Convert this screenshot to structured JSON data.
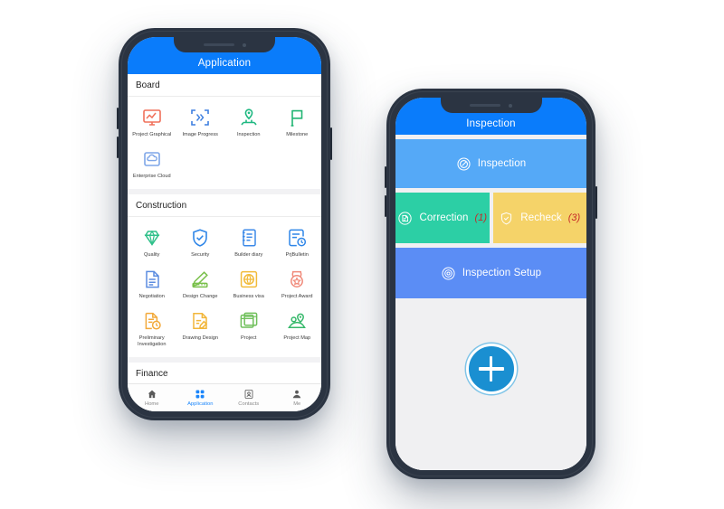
{
  "phone_one": {
    "appbar_title": "Application",
    "sections": [
      {
        "title": "Board",
        "items": [
          {
            "label": "Project Graphical",
            "icon": "monitor-chart-icon",
            "color": "#f0705a"
          },
          {
            "label": "Image Progress",
            "icon": "image-progress-icon",
            "color": "#3d7fe0"
          },
          {
            "label": "Inspection",
            "icon": "map-pin-inspection-icon",
            "color": "#1eb881"
          },
          {
            "label": "Milestone",
            "icon": "flag-icon",
            "color": "#21b573"
          },
          {
            "label": "Enterprise Cloud",
            "icon": "cloud-box-icon",
            "color": "#7ea6e8"
          }
        ]
      },
      {
        "title": "Construction",
        "items": [
          {
            "label": "Quality",
            "icon": "diamond-icon",
            "color": "#2fc08a"
          },
          {
            "label": "Security",
            "icon": "shield-check-icon",
            "color": "#2f86e8"
          },
          {
            "label": "Builder diary",
            "icon": "notebook-icon",
            "color": "#3d8ae8"
          },
          {
            "label": "PrjBulletin",
            "icon": "bulletin-clock-icon",
            "color": "#2f86e8"
          },
          {
            "label": "Negotiation",
            "icon": "document-lines-icon",
            "color": "#5b8ce0"
          },
          {
            "label": "Design Change",
            "icon": "pencil-ruler-icon",
            "color": "#79c04a"
          },
          {
            "label": "Business visa",
            "icon": "globe-box-icon",
            "color": "#f2bb3a"
          },
          {
            "label": "Project Award",
            "icon": "award-star-icon",
            "color": "#f08a7a"
          },
          {
            "label": "Preliminary Investigation",
            "icon": "doc-clock-icon",
            "color": "#f2a93a"
          },
          {
            "label": "Drawing Design",
            "icon": "drawing-edit-icon",
            "color": "#f2b63a"
          },
          {
            "label": "Project",
            "icon": "folders-icon",
            "color": "#6fbf5a"
          },
          {
            "label": "Project Map",
            "icon": "map-marker-icon",
            "color": "#35b86a"
          }
        ]
      },
      {
        "title": "Finance",
        "items": []
      }
    ],
    "tabbar": [
      {
        "label": "Home",
        "icon": "home-icon",
        "active": false
      },
      {
        "label": "Application",
        "icon": "grid-apps-icon",
        "active": true
      },
      {
        "label": "Contacts",
        "icon": "contacts-icon",
        "active": false
      },
      {
        "label": "Me",
        "icon": "person-icon",
        "active": false
      }
    ]
  },
  "phone_two": {
    "appbar_title": "Inspection",
    "cards": [
      {
        "id": "inspection",
        "label": "Inspection",
        "count": "",
        "icon": "inspection-circle-icon",
        "color": "#55a9f7"
      },
      {
        "id": "correction",
        "label": "Correction",
        "count": "(1)",
        "icon": "correction-doc-icon",
        "color": "#2ccfa5"
      },
      {
        "id": "recheck",
        "label": "Recheck",
        "count": "(3)",
        "icon": "shield-check-icon",
        "color": "#f5d369"
      },
      {
        "id": "inspection-setup",
        "label": "Inspection Setup",
        "count": "",
        "icon": "gear-target-icon",
        "color": "#5b8df5"
      }
    ],
    "fab_label": "+"
  },
  "theme": {
    "appbar_blue": "#0a7cfb",
    "accent_blue": "#1b86fb",
    "page_bg": "#f0f0f2",
    "count_red": "#c62828"
  }
}
